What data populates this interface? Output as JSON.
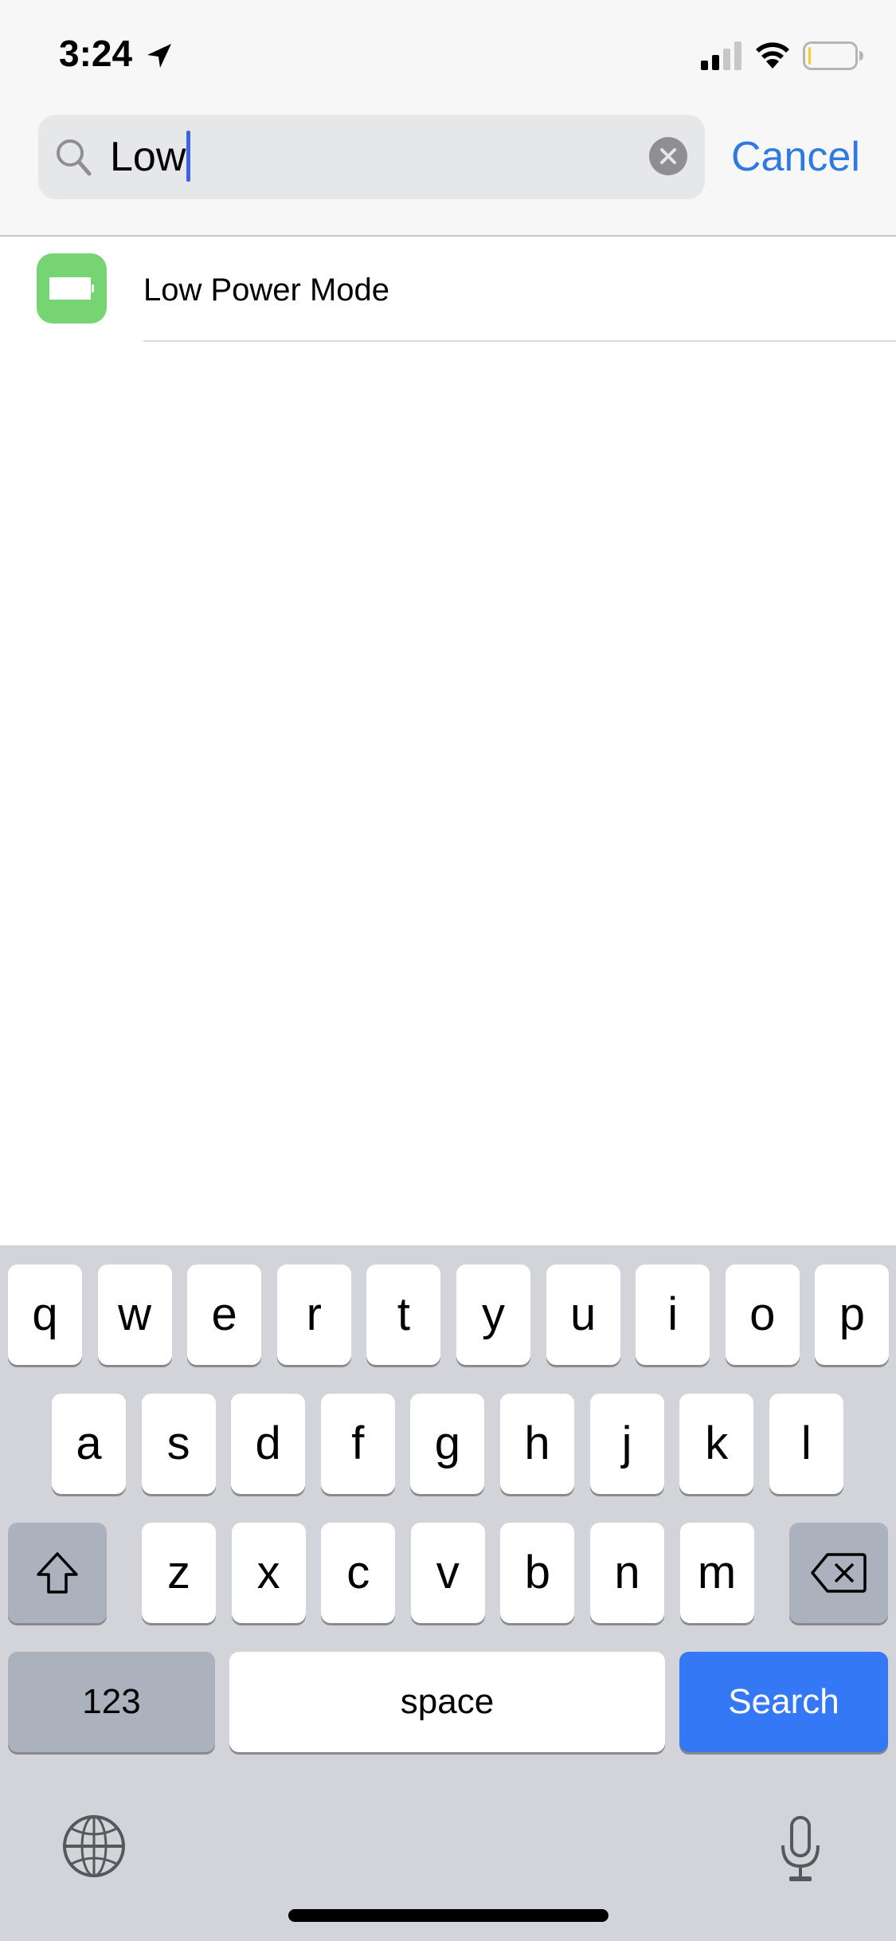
{
  "status_bar": {
    "time": "3:24",
    "icons": [
      "location-arrow-icon",
      "cellular-signal-icon",
      "wifi-icon",
      "battery-icon"
    ],
    "signal_bars_active": 2,
    "signal_bars_total": 4,
    "battery_level_color": "#f2d12b"
  },
  "search": {
    "value": "Low",
    "icon": "search-icon",
    "clear_icon": "clear-text-icon",
    "cancel_label": "Cancel"
  },
  "results": [
    {
      "label": "Low Power Mode",
      "icon": "battery-icon",
      "icon_color": "#76d572"
    }
  ],
  "keyboard": {
    "rows": [
      [
        "q",
        "w",
        "e",
        "r",
        "t",
        "y",
        "u",
        "i",
        "o",
        "p"
      ],
      [
        "a",
        "s",
        "d",
        "f",
        "g",
        "h",
        "j",
        "k",
        "l"
      ],
      [
        "z",
        "x",
        "c",
        "v",
        "b",
        "n",
        "m"
      ]
    ],
    "shift_icon": "shift-icon",
    "delete_icon": "delete-backspace-icon",
    "numbers_label": "123",
    "space_label": "space",
    "return_label": "Search",
    "globe_icon": "globe-icon",
    "mic_icon": "microphone-icon"
  },
  "colors": {
    "accent": "#2f7ae0",
    "return_key": "#3478f6",
    "keyboard_bg": "#d2d4d9"
  }
}
